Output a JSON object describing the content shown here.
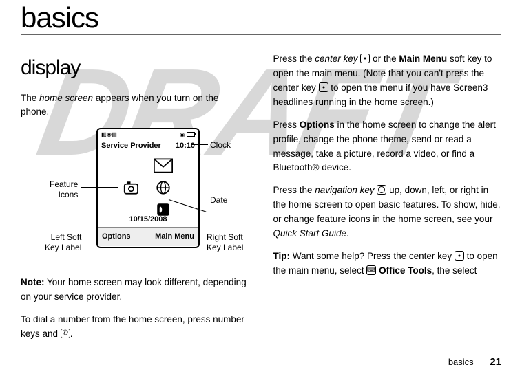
{
  "page": {
    "title": "basics",
    "footer_label": "basics",
    "footer_page": "21"
  },
  "watermark": "DRAFT",
  "left": {
    "subhead": "display",
    "p1_a": "The ",
    "p1_em": "home screen",
    "p1_b": " appears when you turn on the phone.",
    "note_label": "Note:",
    "note_body": " Your home screen may look different, depending on your service provider.",
    "p3": "To dial a number from the home screen, press number keys and "
  },
  "diagram": {
    "service_provider": "Service Provider",
    "clock": "10:10",
    "date": "10/15/2008",
    "soft_left": "Options",
    "soft_right": "Main Menu",
    "callouts": {
      "clock": "Clock",
      "feature_icons_l1": "Feature",
      "feature_icons_l2": "Icons",
      "date": "Date",
      "left_soft_l1": "Left Soft",
      "left_soft_l2": "Key Label",
      "right_soft_l1": "Right Soft",
      "right_soft_l2": "Key Label"
    }
  },
  "right": {
    "p1_a": "Press the ",
    "p1_em": "center key",
    "p1_b": " or the ",
    "p1_bold1": "Main Menu",
    "p1_c": " soft key to open the main menu. (Note that you can't press the center key ",
    "p1_d": " to open the menu if you have Screen3 headlines running in the home screen.)",
    "p2_a": "Press ",
    "p2_bold1": "Options",
    "p2_b": " in the home screen to change the alert profile, change the phone theme, send or read a message, take a picture, record a video, or find a Bluetooth® device.",
    "p3_a": "Press the ",
    "p3_em": "navigation key",
    "p3_b": " up, down, left, or right in the home screen to open basic features. To show, hide, or change feature icons in the home screen, see your ",
    "p3_em2": "Quick Start Guide",
    "p3_c": ".",
    "p4_a": "Tip:",
    "p4_b": " Want some help? Press the center key ",
    "p4_c": " to open the main menu, select ",
    "p4_bold1": "Office Tools",
    "p4_d": ", the select"
  }
}
